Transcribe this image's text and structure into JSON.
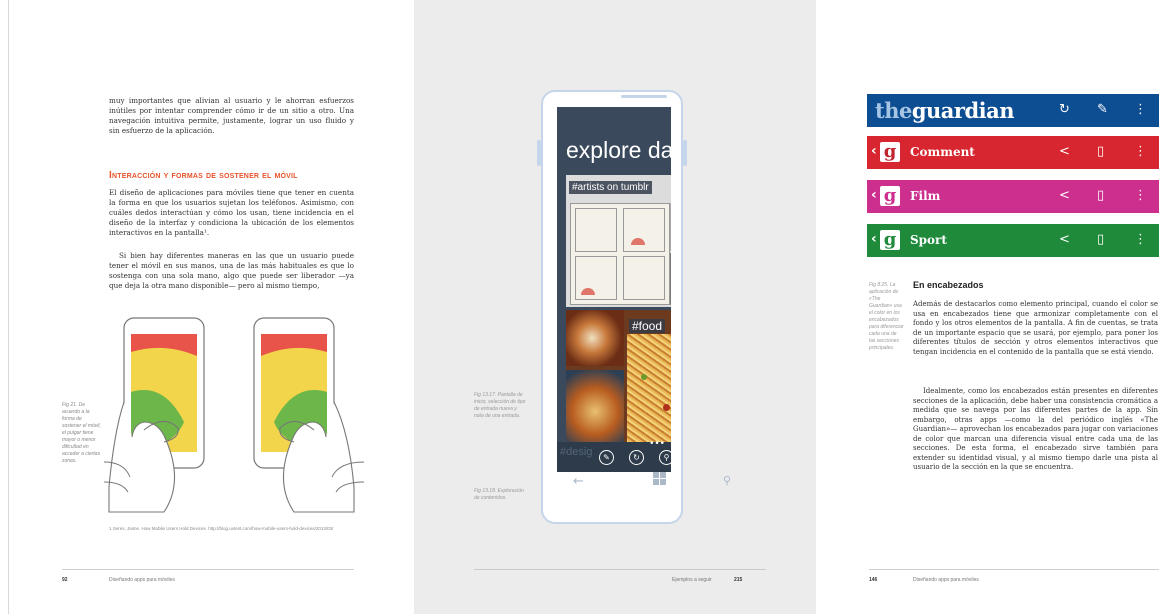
{
  "page1": {
    "intro": "muy importantes que alivian al usuario y le ahorran esfuerzos inútiles por intentar comprender cómo ir de un sitio a otro. Una navegación intuitiva permite, justamente, lograr un uso fluido y sin esfuerzo de la aplicación.",
    "section_title": "Interacción y formas de sostener el móvil",
    "para1": "El diseño de aplicaciones para móviles tiene que tener en cuenta la forma en que los usuarios sujetan los teléfonos. Asimismo, con cuáles dedos interactúan y cómo los usan, tiene incidencia en el diseño de la interfaz y condiciona la ubicación de los elementos interactivos en la pantalla¹.",
    "para2": "Si bien hay diferentes maneras en las que un usuario puede tener el móvil en sus manos, una de las más habituales es que lo sostenga con una sola mano, algo que puede ser liberador —ya que deja la otra mano disponible— pero al mismo tiempo,",
    "fig_caption": "Fig 21. De acuerdo a la forma de sostener el móvil, el pulgar tiene mayor o menor dificultad en acceder a ciertas zonas.",
    "footnote": "1  Seres, Jaime. How Mobile Users Hold Devices. http://blog.uxtest.com/how-mobile-users-hold-devices/2013/03/",
    "folio_number": "92",
    "folio_title": "Diseñando apps para móviles"
  },
  "page2": {
    "screen_title": "explore dashbo",
    "tile1_label": "#artists on tumblr",
    "tile2_label": "#food",
    "tile3_label": "#desig",
    "caption1": "Fig 13.17. Pantalla de inicio, selección de tipo de entrada nueva y nota de una entrada.",
    "caption2": "Fig 13.18. Exploración de contenidos.",
    "folio_title": "Ejemplos a seguir",
    "folio_number": "215",
    "icons": [
      "edit-icon",
      "refresh-icon",
      "search-icon",
      "more-icon",
      "back-icon",
      "windows-icon",
      "search-icon"
    ]
  },
  "page3": {
    "logo_the": "the",
    "logo_guardian": "guardian",
    "bars": [
      {
        "label": "Comment",
        "color": "#d7262f"
      },
      {
        "label": "Film",
        "color": "#cc2f8e"
      },
      {
        "label": "Sport",
        "color": "#1e8a3a"
      }
    ],
    "header_color": "#0d4d91",
    "fig_caption": "Fig 8.25. La aplicación de «The Guardian» usa el color en los encabezados para diferenciar cada una de las secciones principales.",
    "heading": "En encabezados",
    "para1": "Además de destacarlos como elemento principal, cuando el color se usa en encabezados tiene que armonizar completamente con el fondo y los otros elementos de la pantalla. A fin de cuentas, se trata de un importante espacio que se usará, por ejemplo, para poner los diferentes títulos de sección y otros elementos interactivos que tengan incidencia en el contenido de la pantalla que se está viendo.",
    "para2": "Idealmente, como los encabezados están presentes en diferentes secciones de la aplicación, debe haber una consistencia cromática a medida que se navega por las diferentes partes de la app. Sin embargo, otras apps —como la del periódico inglés «The Guardian»— aprovechan los encabezados para jugar con variaciones de color que marcan una diferencia visual entre cada una de las secciones. De esta forma, el encabezado sirve también para extender su identidad visual, y al mismo tiempo darle una pista al usuario de la sección en la que se encuentra.",
    "folio_number": "146",
    "folio_title": "Diseñando apps para móviles"
  }
}
